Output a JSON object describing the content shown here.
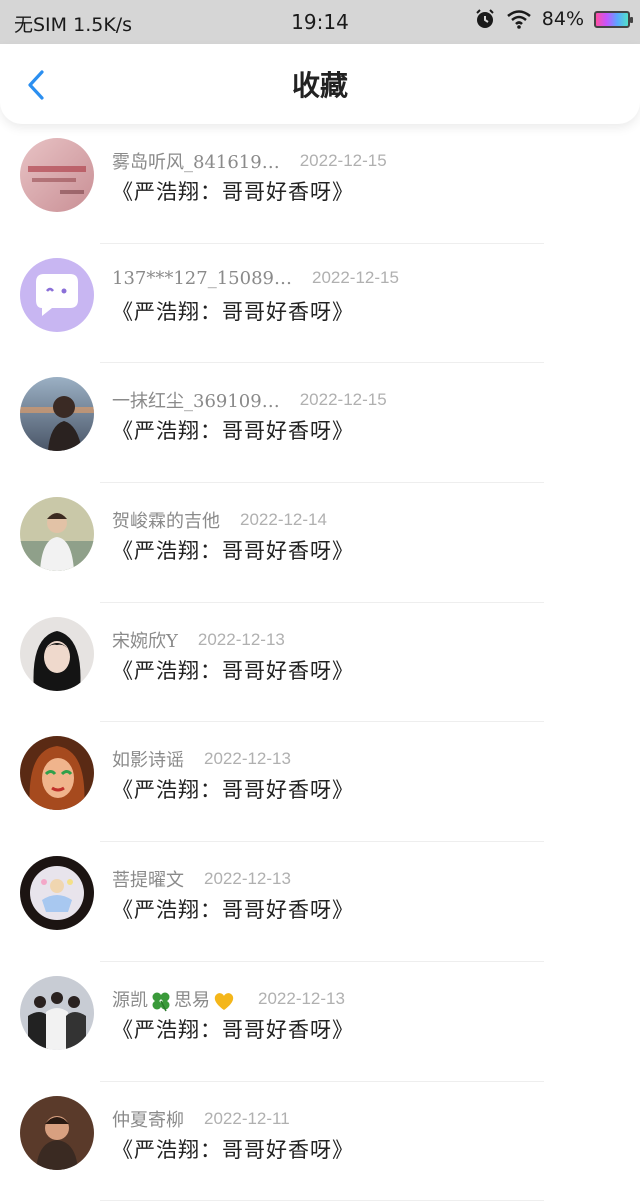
{
  "status_bar": {
    "carrier": "无SIM",
    "net_speed": "1.5K/s",
    "time": "19:14",
    "battery": "84%"
  },
  "nav": {
    "title": "收藏",
    "back_icon": "chevron-left-icon",
    "accent_color": "#2b8ff0"
  },
  "favorites": [
    {
      "user": "雾岛听风_841619…",
      "date": "2022-12-15",
      "content": "《严浩翔：哥哥好香呀》"
    },
    {
      "user": "137***127_15089…",
      "date": "2022-12-15",
      "content": "《严浩翔：哥哥好香呀》"
    },
    {
      "user": "一抹红尘_369109…",
      "date": "2022-12-15",
      "content": "《严浩翔：哥哥好香呀》"
    },
    {
      "user": "贺峻霖的吉他",
      "date": "2022-12-14",
      "content": "《严浩翔：哥哥好香呀》"
    },
    {
      "user": "宋婉欣Y",
      "date": "2022-12-13",
      "content": "《严浩翔：哥哥好香呀》"
    },
    {
      "user": "如影诗谣",
      "date": "2022-12-13",
      "content": "《严浩翔：哥哥好香呀》"
    },
    {
      "user": "菩提曜文",
      "date": "2022-12-13",
      "content": "《严浩翔：哥哥好香呀》"
    },
    {
      "user_prefix": "源凯",
      "user_middle": "思易",
      "date": "2022-12-13",
      "content": "《严浩翔：哥哥好香呀》"
    },
    {
      "user": "仲夏寄柳",
      "date": "2022-12-11",
      "content": "《严浩翔：哥哥好香呀》"
    }
  ]
}
